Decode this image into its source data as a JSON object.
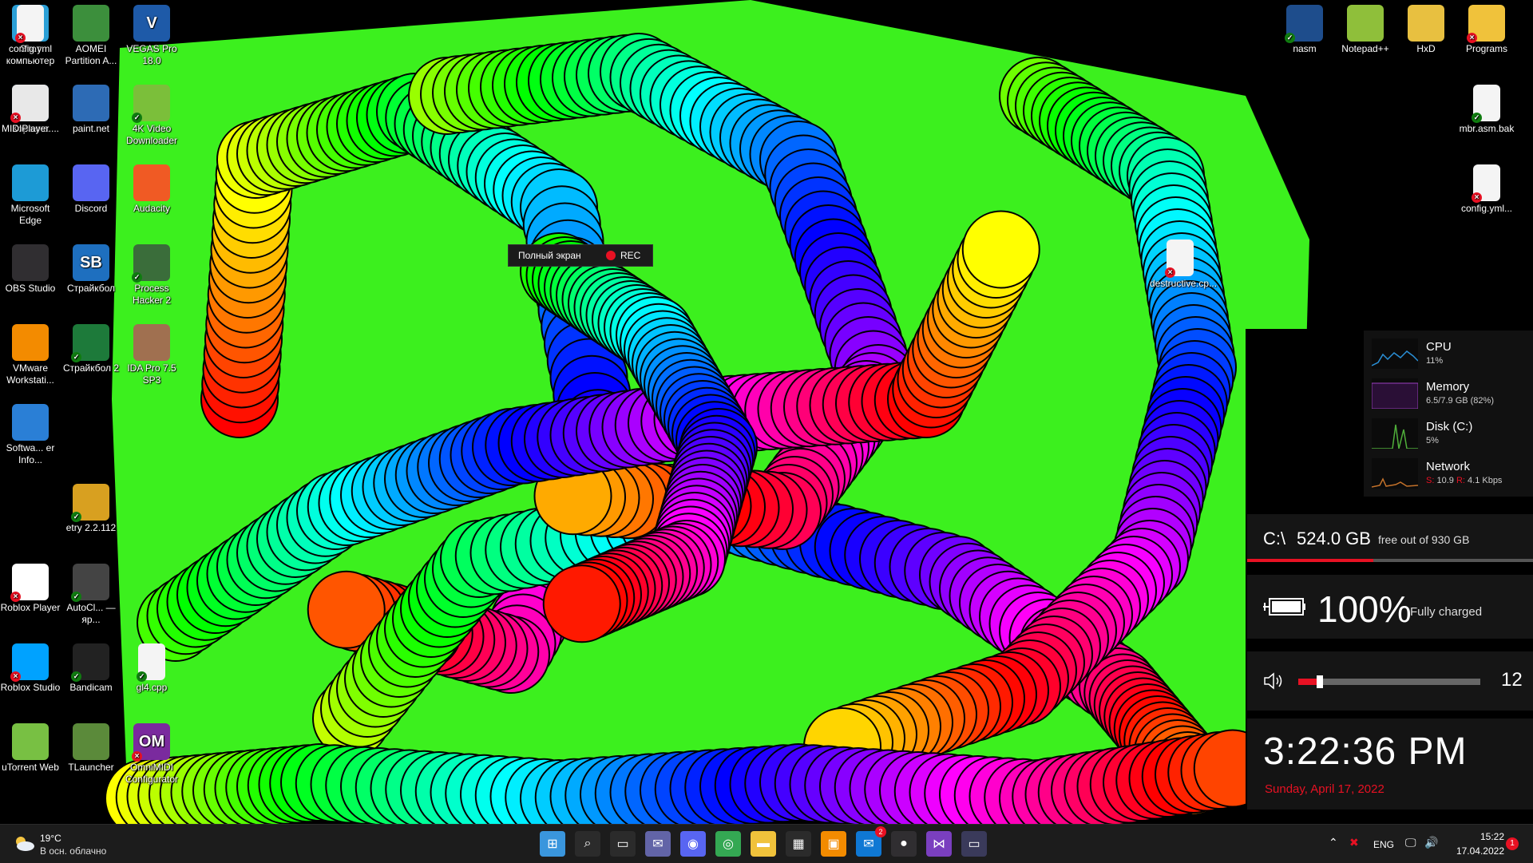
{
  "desktop_icons": [
    {
      "label": "Этот компьютер",
      "icon": "computer-icon",
      "color": "#2a9fd6"
    },
    {
      "label": "AOMEI Partition A...",
      "icon": "aomei-icon",
      "color": "#3c8f3c"
    },
    {
      "label": "VEGAS Pro 18.0",
      "icon": "vegas-icon",
      "color": "#1e5aa8",
      "glyph": "V"
    },
    {
      "label": "config.yml",
      "icon": "file-icon",
      "color": "#f4f4f4"
    },
    {
      "label": "Корзина",
      "icon": "recycle-bin-icon",
      "color": "#3f7fbf"
    },
    {
      "label": "paint.net",
      "icon": "paintnet-icon",
      "color": "#2d6bb5"
    },
    {
      "label": "4K Video Downloader",
      "icon": "4k-downloader-icon",
      "color": "#7bbf3a"
    },
    {
      "label": "MIDIPlayer....",
      "icon": "java-icon",
      "color": "#e8e8e8"
    },
    {
      "label": "Microsoft Edge",
      "icon": "edge-icon",
      "color": "#1d9bd6"
    },
    {
      "label": "Discord",
      "icon": "discord-icon",
      "color": "#5865f2"
    },
    {
      "label": "Audacity",
      "icon": "audacity-icon",
      "color": "#f05a24"
    },
    {
      "label": "OBS Studio",
      "icon": "obs-icon",
      "color": "#302e31"
    },
    {
      "label": "Страйкбол",
      "icon": "sb-icon",
      "color": "#1e6fbf",
      "glyph": "SB"
    },
    {
      "label": "Process Hacker 2",
      "icon": "process-hacker-icon",
      "color": "#3a6d3a"
    },
    {
      "label": "VMware Workstati...",
      "icon": "vmware-icon",
      "color": "#f38b00"
    },
    {
      "label": "Страйкбол 2",
      "icon": "strikeball2-icon",
      "color": "#1d7a3a"
    },
    {
      "label": "IDA Pro 7.5 SP3",
      "icon": "ida-icon",
      "color": "#a07050"
    },
    {
      "label": "Softwa... er Info...",
      "icon": "software-icon",
      "color": "#2a7fd6"
    },
    {
      "label": "etry 2.2.112",
      "icon": "etry-icon",
      "color": "#d8a020"
    },
    {
      "label": "Roblox Player",
      "icon": "roblox-icon",
      "color": "#ffffff"
    },
    {
      "label": "AutoCl... — яр...",
      "icon": "mouse-icon",
      "color": "#444444"
    },
    {
      "label": "Roblox Studio",
      "icon": "roblox-studio-icon",
      "color": "#00a2ff"
    },
    {
      "label": "Bandicam",
      "icon": "bandicam-icon",
      "color": "#222222"
    },
    {
      "label": "gl4.cpp",
      "icon": "cpp-file-icon",
      "color": "#f4f4f4"
    },
    {
      "label": "uTorrent Web",
      "icon": "utorrent-icon",
      "color": "#78c043"
    },
    {
      "label": "TLauncher",
      "icon": "tlauncher-icon",
      "color": "#5b8a3a"
    },
    {
      "label": "OmniMIDI Configurator",
      "icon": "omnimidi-icon",
      "color": "#7a2a9e",
      "glyph": "OM"
    },
    {
      "label": "nasm",
      "icon": "nasm-icon",
      "color": "#1e4d8c"
    },
    {
      "label": "Notepad++",
      "icon": "notepadpp-icon",
      "color": "#8fbf3a"
    },
    {
      "label": "HxD",
      "icon": "hxd-icon",
      "color": "#e8c040"
    },
    {
      "label": "Programs",
      "icon": "folder-icon",
      "color": "#f0c23b"
    },
    {
      "label": "mbr.asm.bak",
      "icon": "file-icon",
      "color": "#f4f4f4"
    },
    {
      "label": "config.yml...",
      "icon": "file-icon",
      "color": "#f4f4f4"
    },
    {
      "label": "destructive.cp...",
      "icon": "file-icon",
      "color": "#f4f4f4"
    }
  ],
  "recorder": {
    "mode": "Полный экран",
    "rec": "REC"
  },
  "perf": [
    {
      "name": "CPU",
      "value": "11%",
      "color": "#2a8fd6"
    },
    {
      "name": "Memory",
      "value": "6.5/7.9 GB (82%)",
      "color": "#9b3fbf"
    },
    {
      "name": "Disk (C:)",
      "value": "5%",
      "color": "#4fae3a"
    },
    {
      "name": "Network",
      "value_s_label": "S:",
      "value_s": "10.9",
      "value_r_label": "R:",
      "value_r": "4.1 Kbps",
      "color": "#c4722a"
    }
  ],
  "disk": {
    "path": "C:\\",
    "free": "524.0 GB",
    "of": "free out of 930 GB",
    "used_fraction": 0.44
  },
  "battery": {
    "percent": "100%",
    "state": "Fully charged"
  },
  "volume": {
    "level": "12",
    "fraction": 0.12
  },
  "clock": {
    "time": "3:22:36 PM",
    "date": "Sunday, April 17, 2022"
  },
  "taskbar": {
    "weather_temp": "19°C",
    "weather_desc": "В осн. облачно",
    "lang": "ENG",
    "time": "15:22",
    "date": "17.04.2022",
    "notifications": "1",
    "store_badge": "2",
    "apps": [
      "start-icon",
      "search-icon",
      "task-view-icon",
      "chat-icon",
      "discord-icon",
      "chrome-icon",
      "explorer-icon",
      "store-icon",
      "vmware-icon",
      "mail-icon",
      "obs-icon",
      "visual-studio-icon",
      "terminal-icon"
    ]
  }
}
